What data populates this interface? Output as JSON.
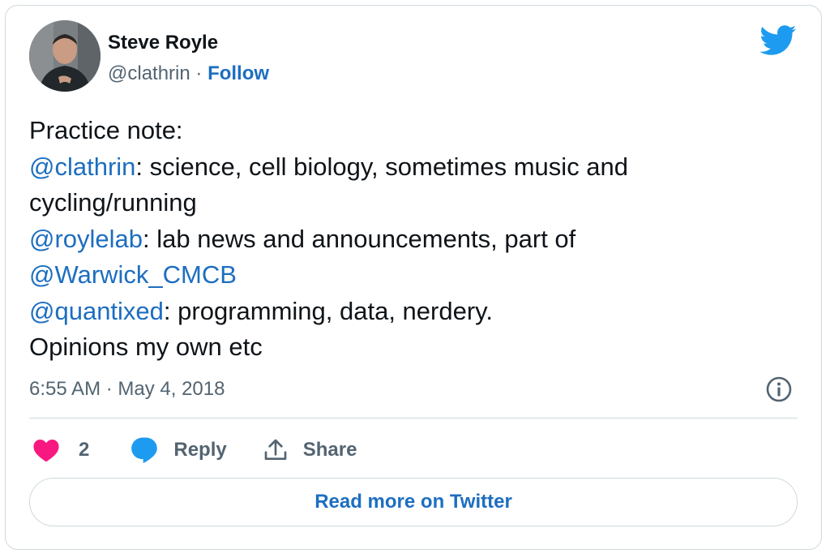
{
  "author": {
    "name": "Steve Royle",
    "handle": "@clathrin",
    "separator": " · ",
    "follow_label": "Follow"
  },
  "icons": {
    "brand": "twitter-bird-icon",
    "info": "info-icon",
    "like": "heart-icon",
    "reply": "speech-bubble-icon",
    "share": "upload-icon"
  },
  "tweet": {
    "line1": "Practice note:",
    "line2_mention": "@clathrin",
    "line2_text": ": science, cell biology, sometimes music and",
    "line3": "cycling/running",
    "line4_mention": "@roylelab",
    "line4_text": ": lab news and announcements, part of",
    "line5_mention": "@Warwick_CMCB",
    "line6_mention": "@quantixed",
    "line6_text": ": programming, data, nerdery.",
    "line7": "Opinions my own etc"
  },
  "timestamp": "6:55 AM · May 4, 2018",
  "actions": {
    "like_count": "2",
    "reply_label": "Reply",
    "share_label": "Share"
  },
  "read_more_label": "Read more on Twitter",
  "colors": {
    "link": "#1d6ec0",
    "twitter_blue": "#1d9bf0",
    "like_pink": "#f91880",
    "secondary_text": "#536471",
    "border": "#cfd9de"
  }
}
